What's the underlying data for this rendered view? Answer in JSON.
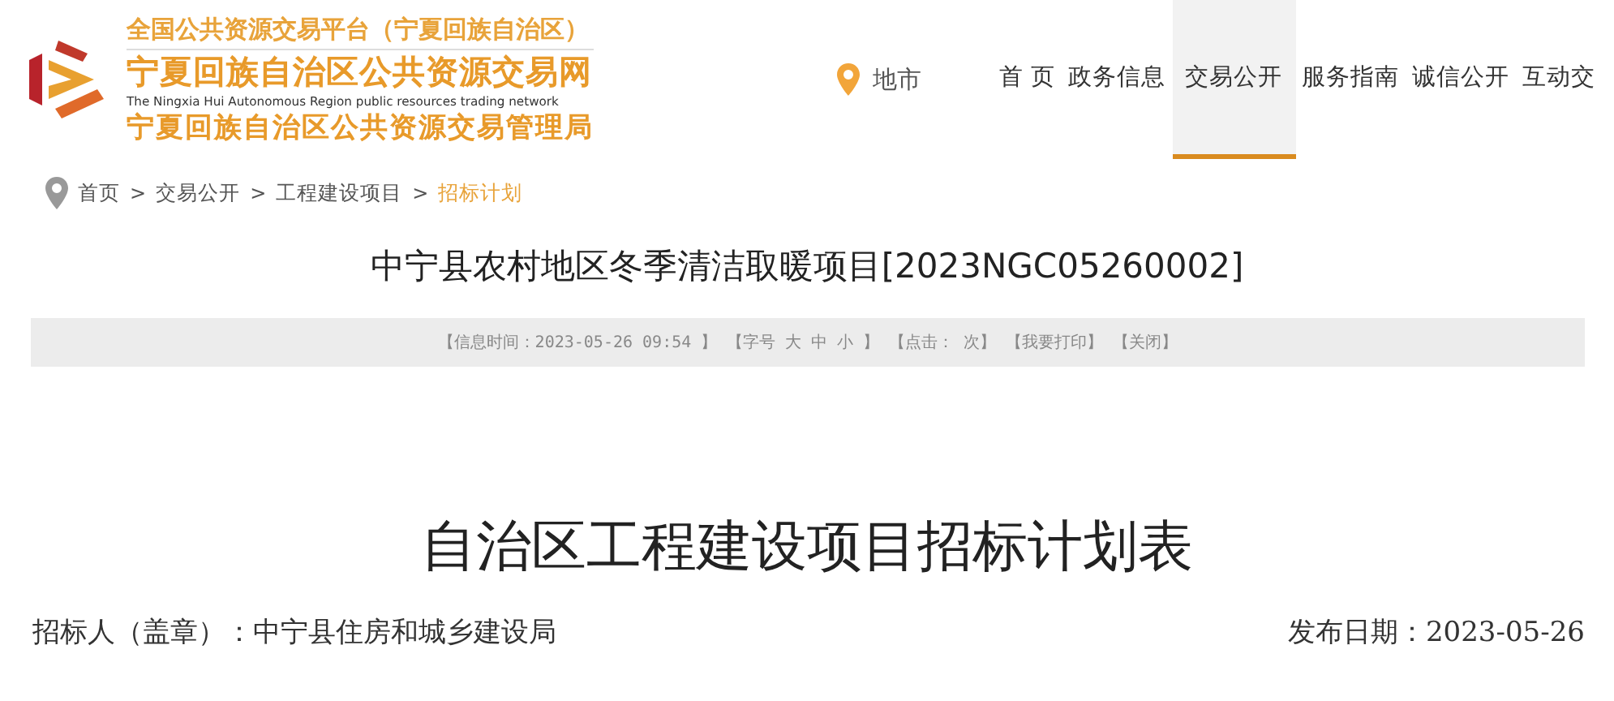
{
  "header": {
    "platform_title": "全国公共资源交易平台（宁夏回族自治区）",
    "site_title": "宁夏回族自治区公共资源交易网",
    "english_title": "The Ningxia Hui Autonomous Region public resources trading network",
    "bureau_title": "宁夏回族自治区公共资源交易管理局"
  },
  "location": {
    "label": "地市"
  },
  "nav": [
    {
      "label": "首 页",
      "selected": false
    },
    {
      "label": "政务信息",
      "selected": false
    },
    {
      "label": "交易公开",
      "selected": true
    },
    {
      "label": "服务指南",
      "selected": false
    },
    {
      "label": "诚信公开",
      "selected": false
    },
    {
      "label": "互动交",
      "selected": false
    }
  ],
  "breadcrumb": [
    {
      "label": "首页",
      "current": false
    },
    {
      "label": "交易公开",
      "current": false
    },
    {
      "label": "工程建设项目",
      "current": false
    },
    {
      "label": "招标计划",
      "current": true
    }
  ],
  "breadcrumb_separator": ">",
  "article_title": "中宁县农村地区冬季清洁取暖项目[2023NGC05260002]",
  "info_bar": {
    "time": "【信息时间：2023-05-26 09:54 】",
    "font_size_open": "【字号",
    "font_sizes": [
      "大",
      "中",
      "小"
    ],
    "font_size_close": "】",
    "clicks": "【点击： 次】",
    "actions": [
      "【我要打印】",
      "【关闭】"
    ]
  },
  "document": {
    "heading": "自治区工程建设项目招标计划表",
    "tenderer": "招标人（盖章）：中宁县住房和城乡建设局",
    "publish_date": "发布日期：2023-05-26"
  }
}
